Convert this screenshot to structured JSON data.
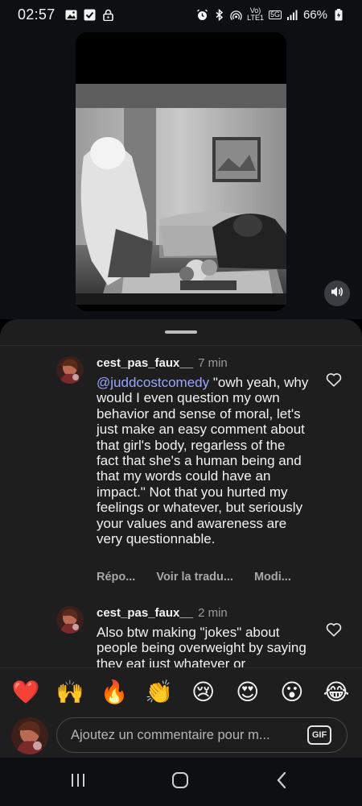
{
  "status_bar": {
    "time": "02:57",
    "network_top": "Vo)",
    "network_bottom": "LTE1",
    "network_badge": "5G",
    "battery": "66%"
  },
  "video": {
    "volume_icon": "speaker-icon"
  },
  "comments": [
    {
      "username": "cest_pas_faux__",
      "time": "7 min",
      "mention": "@juddcostcomedy",
      "text": " \"owh yeah, why would I even question my own behavior and sense of moral, let's just make an easy comment about that girl's body, regarless of the fact that she's a human being and that my words could have an impact.\" Not that you hurted my feelings or whatever, but seriously your values and awareness are very questionnable.",
      "reply_label": "Répo...",
      "translate_label": "Voir la tradu...",
      "edit_label": "Modi..."
    },
    {
      "username": "cest_pas_faux__",
      "time": "2 min",
      "text": "Also btw making \"jokes\" about people being overweight by saying they eat just whatever or"
    }
  ],
  "reactions": [
    "❤️",
    "🙌",
    "🔥",
    "👏",
    "😢",
    "😍",
    "😮",
    "😂"
  ],
  "composer": {
    "placeholder": "Ajoutez un commentaire pour m...",
    "gif_label": "GIF"
  },
  "colors": {
    "sheet_bg": "#1d1e1d",
    "mention": "#9aa5ff",
    "status_bg": "#0d0f12"
  }
}
